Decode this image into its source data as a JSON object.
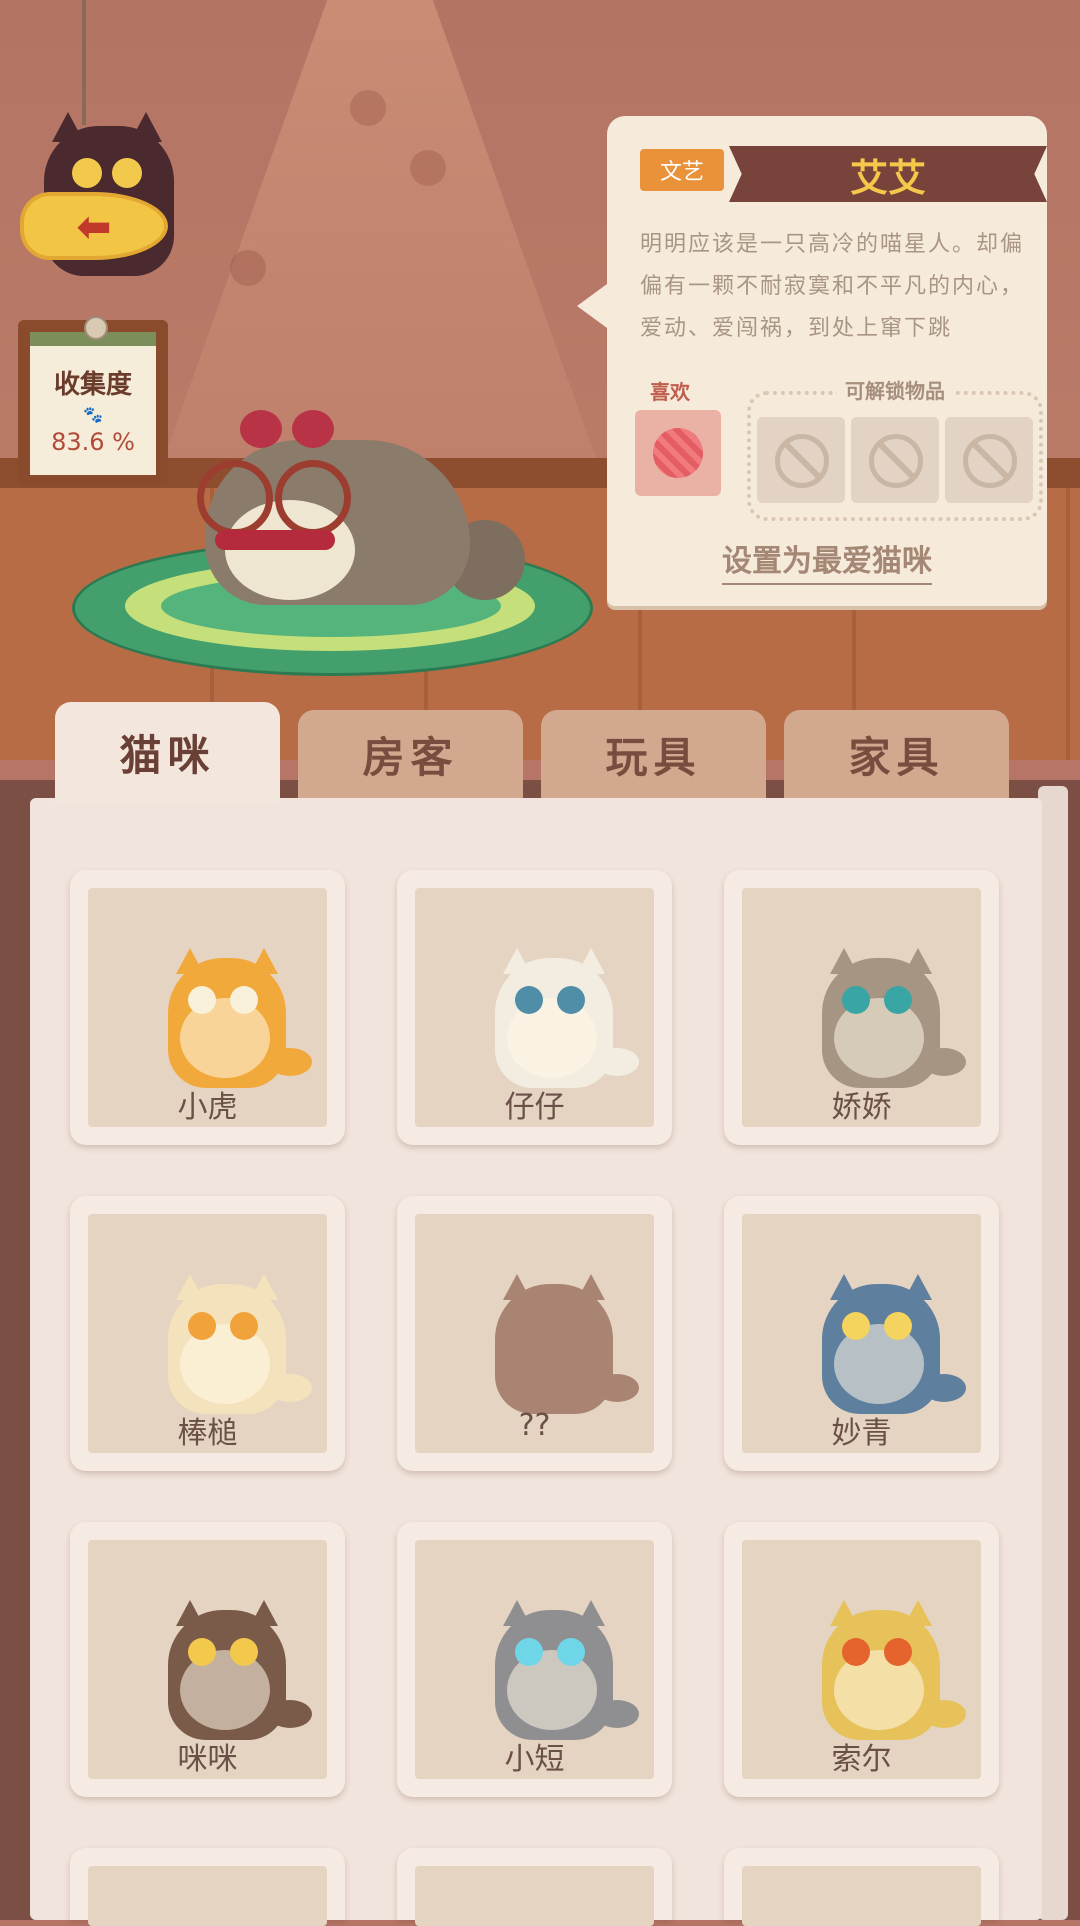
{
  "hud": {
    "back_arrow": "⬅",
    "collection_label": "收集度",
    "collection_paw": "🐾",
    "collection_value": "83.6 %",
    "collection_progress": 0.836
  },
  "detail": {
    "tag": "文艺",
    "name": "艾艾",
    "description": "明明应该是一只高冷的喵星人。却偏偏有一颗不耐寂寞和不平凡的内心，爱动、爱闯祸，到处上窜下跳",
    "likes_label": "喜欢",
    "likes_item_icon": "yarn-ball-icon",
    "unlock_label": "可解锁物品",
    "set_favorite_label": "设置为最爱猫咪"
  },
  "tabs": [
    {
      "label": "猫咪",
      "active": true
    },
    {
      "label": "房客",
      "active": false
    },
    {
      "label": "玩具",
      "active": false
    },
    {
      "label": "家具",
      "active": false
    }
  ],
  "cats": [
    {
      "name": "小虎",
      "body": "#f2a93b",
      "eye": "#f8f0d8"
    },
    {
      "name": "仔仔",
      "body": "#f3ede1",
      "eye": "#4f8ea6"
    },
    {
      "name": "娇娇",
      "body": "#a59582",
      "eye": "#39a5a5"
    },
    {
      "name": "棒槌",
      "body": "#f4e2bd",
      "eye": "#f2a23a"
    },
    {
      "name": "??",
      "body": "#a98473",
      "eye": "#a98473"
    },
    {
      "name": "妙青",
      "body": "#5f7f9e",
      "eye": "#f4d35e"
    },
    {
      "name": "咪咪",
      "body": "#7a5a48",
      "eye": "#f2c94c"
    },
    {
      "name": "小短",
      "body": "#8f8f91",
      "eye": "#6fd6e8"
    },
    {
      "name": "索尔",
      "body": "#e7c25a",
      "eye": "#e5642e"
    }
  ]
}
